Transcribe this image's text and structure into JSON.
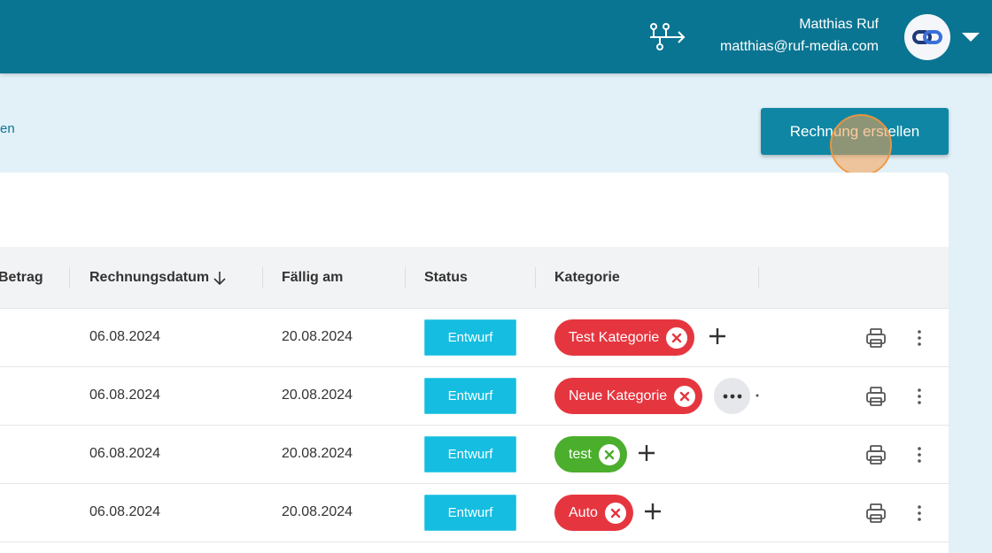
{
  "header": {
    "user_name": "Matthias Ruf",
    "user_email": "matthias@ruf-media.com",
    "flow_icon": "workflow-arrow-icon",
    "avatar_icon": "link-logo-icon"
  },
  "toolbar": {
    "breadcrumb_fragment": "en",
    "create_label": "Rechnung erstellen"
  },
  "table": {
    "columns": [
      "Betrag",
      "Rechnungsdatum",
      "Fällig am",
      "Status",
      "Kategorie"
    ],
    "sort_icon": "arrow-down-icon",
    "rows": [
      {
        "date": "06.08.2024",
        "due": "20.08.2024",
        "status": "Entwurf",
        "category": "Test Kategorie",
        "category_color": "#e5363f",
        "action": "add"
      },
      {
        "date": "06.08.2024",
        "due": "20.08.2024",
        "status": "Entwurf",
        "category": "Neue Kategorie",
        "category_color": "#e5363f",
        "action": "more"
      },
      {
        "date": "06.08.2024",
        "due": "20.08.2024",
        "status": "Entwurf",
        "category": "test",
        "category_color": "#4bae2c",
        "action": "add"
      },
      {
        "date": "06.08.2024",
        "due": "20.08.2024",
        "status": "Entwurf",
        "category": "Auto",
        "category_color": "#e5363f",
        "action": "add"
      }
    ]
  },
  "colors": {
    "header_bg": "#0a7592",
    "page_bg": "#e2f0f8",
    "button_bg": "#0f87a4",
    "status_bg": "#15bde0"
  }
}
